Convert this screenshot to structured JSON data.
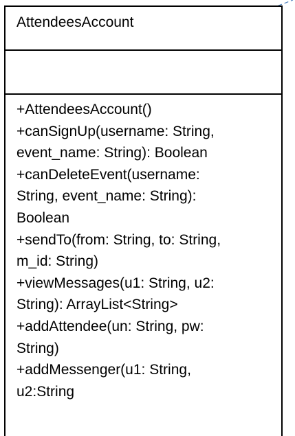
{
  "class_name": "AttendeesAccount",
  "attributes": [],
  "method_lines": [
    "+AttendeesAccount()",
    "+canSignUp(username: String,",
    "event_name: String): Boolean",
    "+canDeleteEvent(username:",
    "String, event_name: String):",
    "Boolean",
    "+sendTo(from: String, to: String,",
    "m_id: String)",
    "+viewMessages(u1: String, u2:",
    "String): ArrayList<String>",
    "+addAttendee(un: String, pw:",
    "String)",
    "+addMessenger(u1: String,",
    "u2:String"
  ],
  "colors": {
    "border": "#000000",
    "text": "#000000",
    "connector": "#4a7ebb",
    "background": "#ffffff"
  }
}
